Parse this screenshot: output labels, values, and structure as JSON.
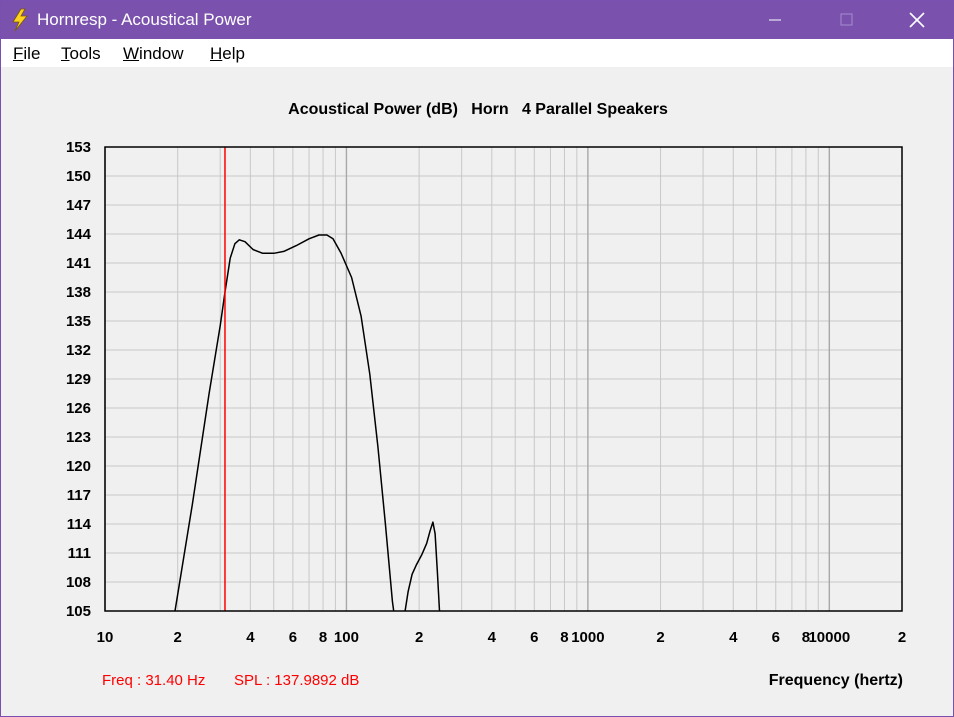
{
  "window": {
    "title": "Hornresp - Acoustical Power",
    "app_icon": "lightning-bolt-icon",
    "controls": [
      "minimize-icon",
      "maximize-icon",
      "close-icon"
    ]
  },
  "menu": {
    "items": [
      {
        "label_ul": "F",
        "label_rest": "ile"
      },
      {
        "label_ul": "T",
        "label_rest": "ools"
      },
      {
        "label_ul": "W",
        "label_rest": "indow"
      },
      {
        "label_ul": "H",
        "label_rest": "elp"
      }
    ]
  },
  "colors": {
    "titlebar": "#7a52ad",
    "curve": "#000000",
    "marker": "#ff0000",
    "grid": "#c8c8c8",
    "readout": "#ff0000"
  },
  "readout": {
    "freq": "Freq : 31.40 Hz",
    "spl": "SPL : 137.9892 dB"
  },
  "chart_data": {
    "type": "line",
    "title": "Acoustical Power (dB)   Horn   4 Parallel Speakers",
    "xlabel": "Frequency (hertz)",
    "ylabel": "",
    "x_scale": "log",
    "xlim": [
      10,
      20000
    ],
    "ylim": [
      105,
      153
    ],
    "y_ticks": [
      105,
      108,
      111,
      114,
      117,
      120,
      123,
      126,
      129,
      132,
      135,
      138,
      141,
      144,
      147,
      150,
      153
    ],
    "x_ticks": [
      {
        "value": 10,
        "label": "10"
      },
      {
        "value": 20,
        "label": "2"
      },
      {
        "value": 40,
        "label": "4"
      },
      {
        "value": 60,
        "label": "6"
      },
      {
        "value": 80,
        "label": "8"
      },
      {
        "value": 100,
        "label": "100"
      },
      {
        "value": 200,
        "label": "2"
      },
      {
        "value": 400,
        "label": "4"
      },
      {
        "value": 600,
        "label": "6"
      },
      {
        "value": 800,
        "label": "8"
      },
      {
        "value": 1000,
        "label": "1000"
      },
      {
        "value": 2000,
        "label": "2"
      },
      {
        "value": 4000,
        "label": "4"
      },
      {
        "value": 6000,
        "label": "6"
      },
      {
        "value": 8000,
        "label": "8"
      },
      {
        "value": 10000,
        "label": "10000"
      },
      {
        "value": 20000,
        "label": "2"
      }
    ],
    "grid": true,
    "marker_x": 31.4,
    "series": [
      {
        "segments": [
          [
            [
              19.5,
              105
            ],
            [
              23,
              116
            ],
            [
              27,
              127.5
            ],
            [
              30,
              134.5
            ],
            [
              31.4,
              138
            ],
            [
              33,
              141.5
            ],
            [
              34.5,
              143
            ],
            [
              36,
              143.4
            ],
            [
              38,
              143.2
            ],
            [
              41,
              142.4
            ],
            [
              45,
              142
            ],
            [
              50,
              142
            ],
            [
              55,
              142.2
            ],
            [
              62,
              142.8
            ],
            [
              70,
              143.5
            ],
            [
              77,
              143.9
            ],
            [
              83,
              143.9
            ],
            [
              88,
              143.5
            ],
            [
              95,
              142
            ],
            [
              105,
              139.5
            ],
            [
              115,
              135.5
            ],
            [
              125,
              129.5
            ],
            [
              135,
              122
            ],
            [
              145,
              114
            ],
            [
              155,
              106
            ],
            [
              157,
              105
            ]
          ],
          [
            [
              175,
              105
            ],
            [
              180,
              107
            ],
            [
              187,
              108.8
            ],
            [
              195,
              109.8
            ],
            [
              205,
              110.8
            ],
            [
              215,
              112
            ],
            [
              222,
              113.3
            ],
            [
              228,
              114.2
            ],
            [
              233,
              113
            ],
            [
              238,
              109
            ],
            [
              243,
              105
            ]
          ]
        ]
      }
    ]
  }
}
